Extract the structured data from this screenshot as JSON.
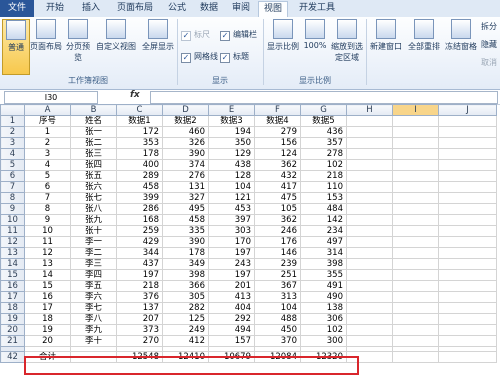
{
  "tabs": [
    {
      "label": "文件",
      "active": false
    },
    {
      "label": "开始",
      "active": false
    },
    {
      "label": "插入",
      "active": false
    },
    {
      "label": "页面布局",
      "active": false
    },
    {
      "label": "公式",
      "active": false
    },
    {
      "label": "数据",
      "active": false
    },
    {
      "label": "审阅",
      "active": false
    },
    {
      "label": "视图",
      "active": true
    },
    {
      "label": "开发工具",
      "active": false
    }
  ],
  "ribbon": {
    "groups": {
      "workbook_views": "工作簿视图",
      "show": "显示",
      "zoom": "显示比例"
    },
    "buttons": {
      "normal": "普通",
      "page_layout": "页面布局",
      "page_break": "分页预览",
      "custom_views": "自定义视图",
      "full_screen": "全屏显示",
      "zoom": "显示比例",
      "zoom_100": "100%",
      "zoom_selection": "缩放到选定区域",
      "new_window": "新建窗口",
      "arrange_all": "全部重排",
      "freeze_panes": "冻结窗格",
      "split": "拆分",
      "hide": "隐藏",
      "unhide": "取消"
    },
    "checks": {
      "ruler": "标尺",
      "formula_bar": "编辑栏",
      "gridlines": "网格线",
      "headings": "标题"
    }
  },
  "formula_bar": {
    "name_box": "I30",
    "fx": "fx",
    "formula": ""
  },
  "grid": {
    "columns": [
      "A",
      "B",
      "C",
      "D",
      "E",
      "F",
      "G",
      "H",
      "I",
      "J"
    ],
    "selected_column": "I",
    "header_row": {
      "row": "1",
      "cells": [
        "序号",
        "姓名",
        "数据1",
        "数据2",
        "数据3",
        "数据4",
        "数据5",
        "",
        "",
        ""
      ]
    },
    "rows": [
      {
        "row": "2",
        "cells": [
          "1",
          "张一",
          "172",
          "460",
          "194",
          "279",
          "436"
        ]
      },
      {
        "row": "3",
        "cells": [
          "2",
          "张二",
          "353",
          "326",
          "350",
          "156",
          "357"
        ]
      },
      {
        "row": "4",
        "cells": [
          "3",
          "张三",
          "178",
          "390",
          "129",
          "124",
          "278"
        ]
      },
      {
        "row": "5",
        "cells": [
          "4",
          "张四",
          "400",
          "374",
          "438",
          "362",
          "102"
        ]
      },
      {
        "row": "6",
        "cells": [
          "5",
          "张五",
          "289",
          "276",
          "128",
          "432",
          "218"
        ]
      },
      {
        "row": "7",
        "cells": [
          "6",
          "张六",
          "458",
          "131",
          "104",
          "417",
          "110"
        ]
      },
      {
        "row": "8",
        "cells": [
          "7",
          "张七",
          "399",
          "327",
          "121",
          "475",
          "153"
        ]
      },
      {
        "row": "9",
        "cells": [
          "8",
          "张八",
          "286",
          "495",
          "453",
          "105",
          "484"
        ]
      },
      {
        "row": "10",
        "cells": [
          "9",
          "张九",
          "168",
          "458",
          "397",
          "362",
          "142"
        ]
      },
      {
        "row": "11",
        "cells": [
          "10",
          "张十",
          "259",
          "335",
          "303",
          "246",
          "234"
        ]
      },
      {
        "row": "12",
        "cells": [
          "11",
          "李一",
          "429",
          "390",
          "170",
          "176",
          "497"
        ]
      },
      {
        "row": "13",
        "cells": [
          "12",
          "李二",
          "344",
          "178",
          "197",
          "146",
          "314"
        ]
      },
      {
        "row": "14",
        "cells": [
          "13",
          "李三",
          "437",
          "349",
          "243",
          "239",
          "398"
        ]
      },
      {
        "row": "15",
        "cells": [
          "14",
          "李四",
          "197",
          "398",
          "197",
          "251",
          "355"
        ]
      },
      {
        "row": "16",
        "cells": [
          "15",
          "李五",
          "218",
          "366",
          "201",
          "367",
          "491"
        ]
      },
      {
        "row": "17",
        "cells": [
          "16",
          "李六",
          "376",
          "305",
          "413",
          "313",
          "490"
        ]
      },
      {
        "row": "18",
        "cells": [
          "17",
          "李七",
          "137",
          "282",
          "404",
          "104",
          "138"
        ]
      },
      {
        "row": "19",
        "cells": [
          "18",
          "李八",
          "207",
          "125",
          "292",
          "488",
          "306"
        ]
      },
      {
        "row": "20",
        "cells": [
          "19",
          "李九",
          "373",
          "249",
          "494",
          "450",
          "102"
        ]
      },
      {
        "row": "21",
        "cells": [
          "20",
          "李十",
          "270",
          "412",
          "157",
          "370",
          "300"
        ]
      }
    ],
    "total_row": {
      "row": "42",
      "label": "合计",
      "cells": [
        "",
        "12548",
        "12410",
        "10679",
        "12084",
        "12320"
      ]
    }
  },
  "colors": {
    "file_tab": "#2a5699",
    "highlight_box": "#d9262c",
    "selected_header": "#f8d58a"
  }
}
